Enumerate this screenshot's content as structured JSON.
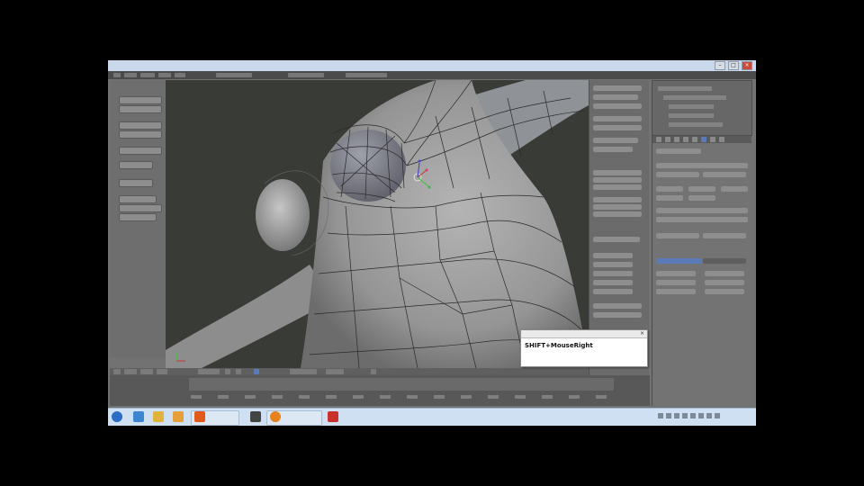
{
  "hint_overlay": {
    "keys_text": "SHIFT+MouseRight",
    "close_glyph": "×"
  },
  "window": {
    "close_glyph": "×",
    "minimize_glyph": "–",
    "maximize_glyph": "□"
  },
  "colors": {
    "viewport_bg": "#393b37",
    "mesh_surface": "#9e9e9e",
    "panel_bg": "#727272",
    "taskbar_bg": "#cfe0f2",
    "selection_blue": "#5a7ab8"
  }
}
